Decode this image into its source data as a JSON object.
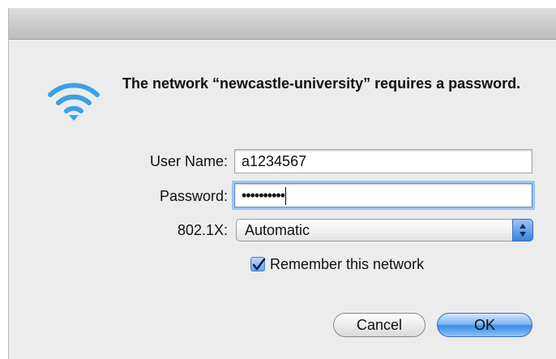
{
  "dialog": {
    "message": "The network “newcastle-university” requires a password.",
    "icon": "wifi-icon"
  },
  "form": {
    "username_label": "User Name:",
    "username_value": "a1234567",
    "password_label": "Password:",
    "password_masked": "••••••••••",
    "eap_label": "802.1X:",
    "eap_value": "Automatic",
    "remember_label": "Remember this network",
    "remember_checked": true
  },
  "buttons": {
    "cancel": "Cancel",
    "ok": "OK"
  },
  "colors": {
    "accent": "#3f8be4",
    "wifi": "#3aa0e8"
  }
}
